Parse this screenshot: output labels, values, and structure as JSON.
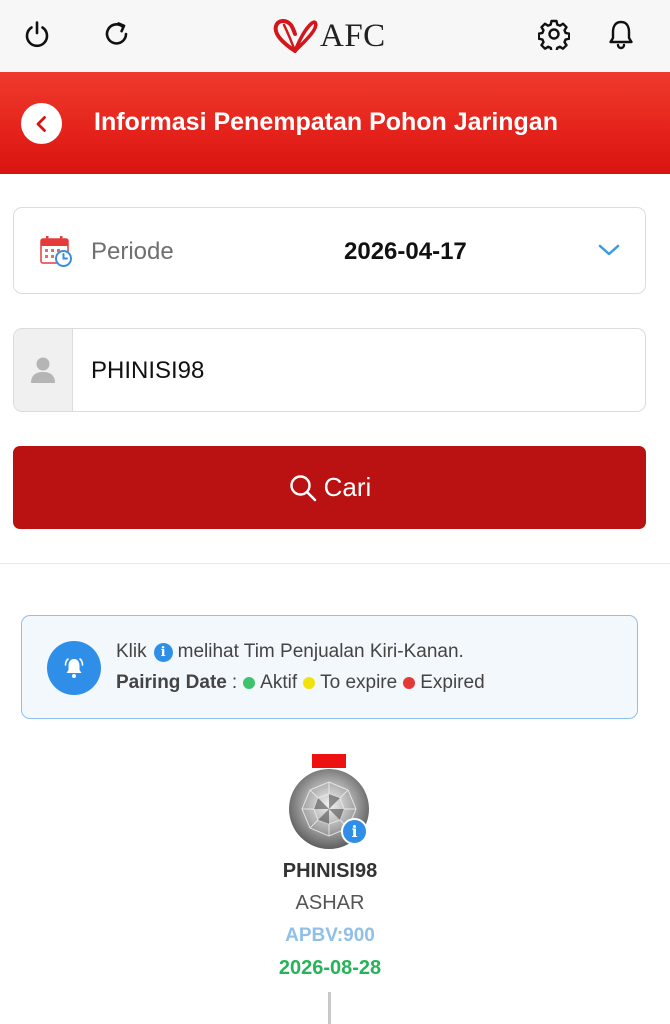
{
  "topbar": {
    "icons": [
      "power-icon",
      "refresh-icon",
      "settings-icon",
      "bell-icon"
    ],
    "logo_text": "AFC"
  },
  "header": {
    "title": "Informasi Penempatan Pohon Jaringan",
    "back_icon": "chevron-left-icon"
  },
  "periode": {
    "label": "Periode",
    "value": "2026-04-17"
  },
  "user_field": {
    "value": "PHINISI98"
  },
  "search_button": {
    "label": "Cari"
  },
  "info": {
    "line1_prefix": "Klik",
    "line1_icon": "i",
    "line1_suffix": "melihat Tim Penjualan Kiri-Kanan.",
    "pairing_label": "Pairing Date",
    "pairing_sep": ":",
    "legend": [
      {
        "label": "Aktif",
        "color": "#3cc36b"
      },
      {
        "label": "To expire",
        "color": "#f2e20b"
      },
      {
        "label": "Expired",
        "color": "#e53935"
      }
    ]
  },
  "node": {
    "info_icon": "i",
    "id": "PHINISI98",
    "name": "ASHAR",
    "apbv": "APBV:900",
    "date": "2026-08-28"
  },
  "colors": {
    "header_red": "#e4221b",
    "button_red": "#ba1212",
    "accent_blue": "#2f8fe8",
    "active_green": "#27b35a"
  }
}
